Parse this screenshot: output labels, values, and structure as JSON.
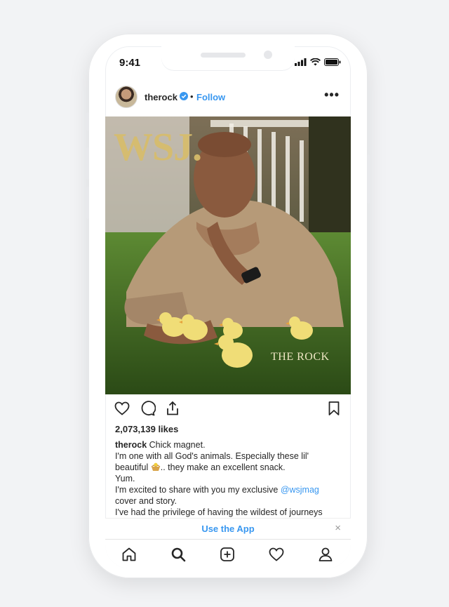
{
  "status_bar": {
    "time": "9:41"
  },
  "post": {
    "username": "therock",
    "separator": "•",
    "follow_label": "Follow",
    "more_label": "•••",
    "image": {
      "magazine_logo": "WSJ.",
      "cover_title": "THE ROCK"
    },
    "likes": "2,073,139 likes",
    "caption": {
      "username": "therock",
      "line1": "Chick magnet.",
      "line2": "I'm one with all God's animals. Especially these lil'",
      "line3_a": "beautiful",
      "line3_b": ".. they make an excellent snack.",
      "line4": "Yum.",
      "line5_a": "I'm excited to share with you my exclusive ",
      "mention": "@wsjmag",
      "line6": "cover and story.",
      "line7": "I've had the privilege of having the wildest of journeys"
    }
  },
  "app_banner": {
    "label": "Use the App",
    "close": "×"
  },
  "tabbar": {
    "items": [
      "home-icon",
      "search-icon",
      "add-post-icon",
      "activity-heart-icon",
      "profile-icon"
    ]
  },
  "colors": {
    "link": "#3897f0",
    "text": "#262626",
    "verified": "#3897f0"
  }
}
